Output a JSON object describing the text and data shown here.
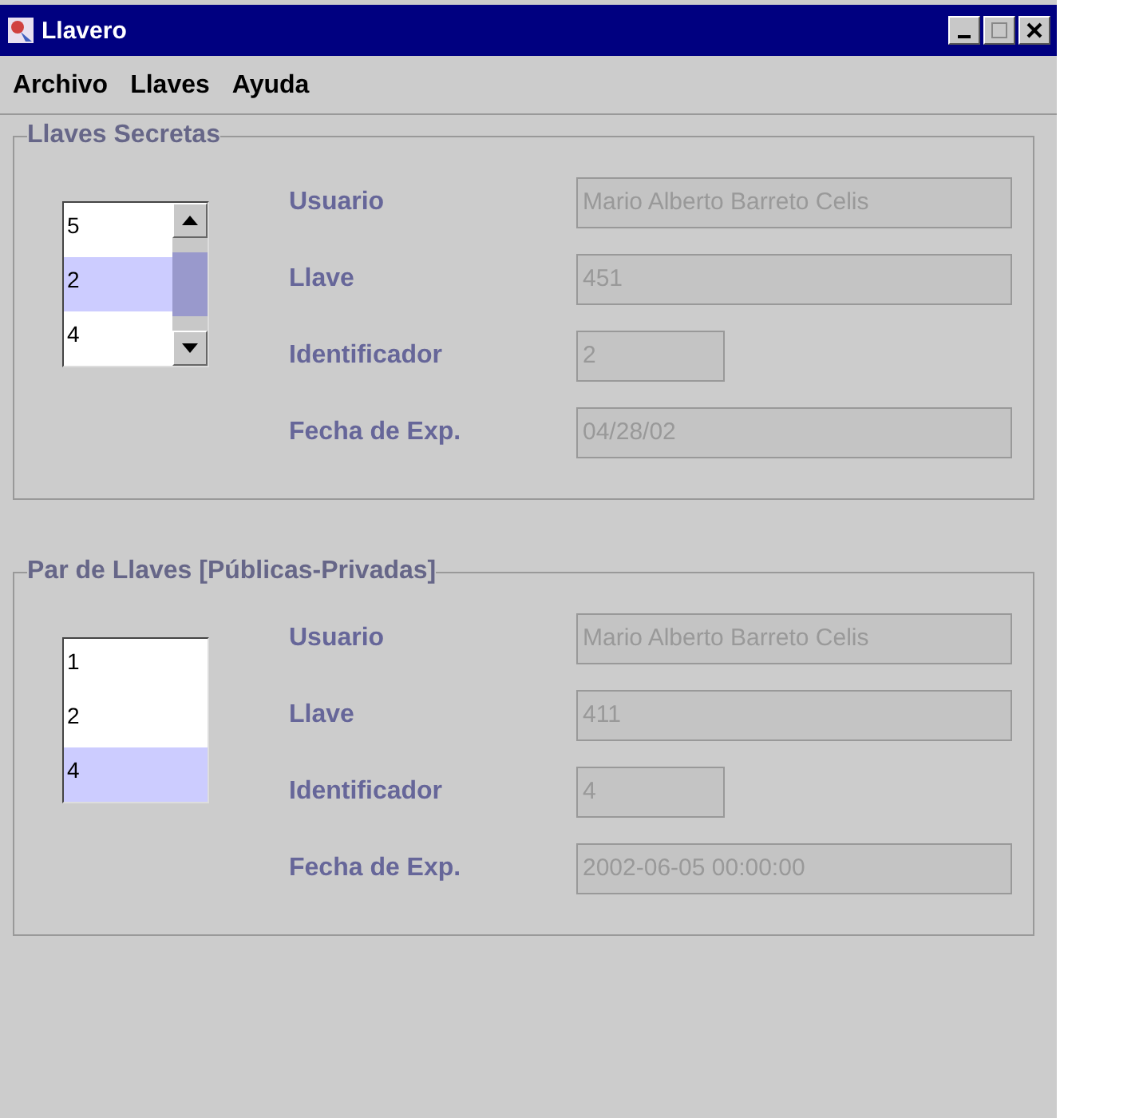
{
  "window": {
    "title": "Llavero"
  },
  "menu": [
    "Archivo",
    "Llaves",
    "Ayuda"
  ],
  "groups": [
    {
      "title": "Llaves Secretas",
      "list": {
        "scrollbar": true,
        "items": [
          {
            "label": "5",
            "selected": false
          },
          {
            "label": "2",
            "selected": true
          },
          {
            "label": "4",
            "selected": false
          }
        ]
      },
      "fields": [
        {
          "label": "Usuario",
          "value": "Mario Alberto Barreto Celis",
          "kind": "wide"
        },
        {
          "label": "Llave",
          "value": "451",
          "kind": "wide"
        },
        {
          "label": "Identificador",
          "value": "2",
          "kind": "short"
        },
        {
          "label": "Fecha de Exp.",
          "value": "04/28/02",
          "kind": "wide"
        }
      ]
    },
    {
      "title": "Par de Llaves [Públicas-Privadas]",
      "list": {
        "scrollbar": false,
        "items": [
          {
            "label": "1",
            "selected": false
          },
          {
            "label": "2",
            "selected": false
          },
          {
            "label": "4",
            "selected": true
          }
        ]
      },
      "fields": [
        {
          "label": "Usuario",
          "value": "Mario Alberto Barreto Celis",
          "kind": "wide"
        },
        {
          "label": "Llave",
          "value": "411",
          "kind": "wide"
        },
        {
          "label": "Identificador",
          "value": "4",
          "kind": "short"
        },
        {
          "label": "Fecha de Exp.",
          "value": "2002-06-05 00:00:00",
          "kind": "wide"
        }
      ]
    }
  ]
}
